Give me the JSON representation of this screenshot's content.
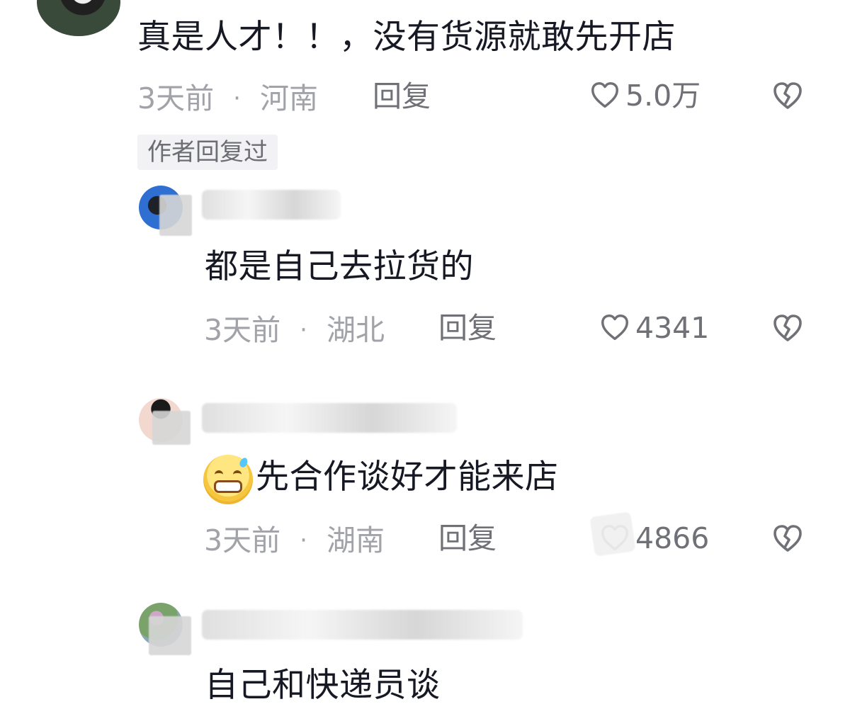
{
  "comments": {
    "main": {
      "text": "真是人才！！，没有货源就敢先开店",
      "time": "3天前",
      "separator": "·",
      "location": "河南",
      "reply_label": "回复",
      "like_count": "5.0万",
      "author_tag": "作者回复过"
    },
    "replies": [
      {
        "text": "都是自己去拉货的",
        "time": "3天前",
        "separator": "·",
        "location": "湖北",
        "reply_label": "回复",
        "like_count": "4341"
      },
      {
        "text": "先合作谈好才能来店",
        "time": "3天前",
        "separator": "·",
        "location": "湖南",
        "reply_label": "回复",
        "like_count": "4866"
      },
      {
        "text": "自己和快递员谈"
      }
    ]
  },
  "icons": {
    "heart": "heart-icon",
    "dislike": "broken-heart-icon",
    "emoji": "sweat-grin-emoji-icon"
  },
  "colors": {
    "text": "#161823",
    "meta": "#a1a3a8",
    "action": "#6f7177",
    "tag_bg": "#f2f2f4"
  }
}
